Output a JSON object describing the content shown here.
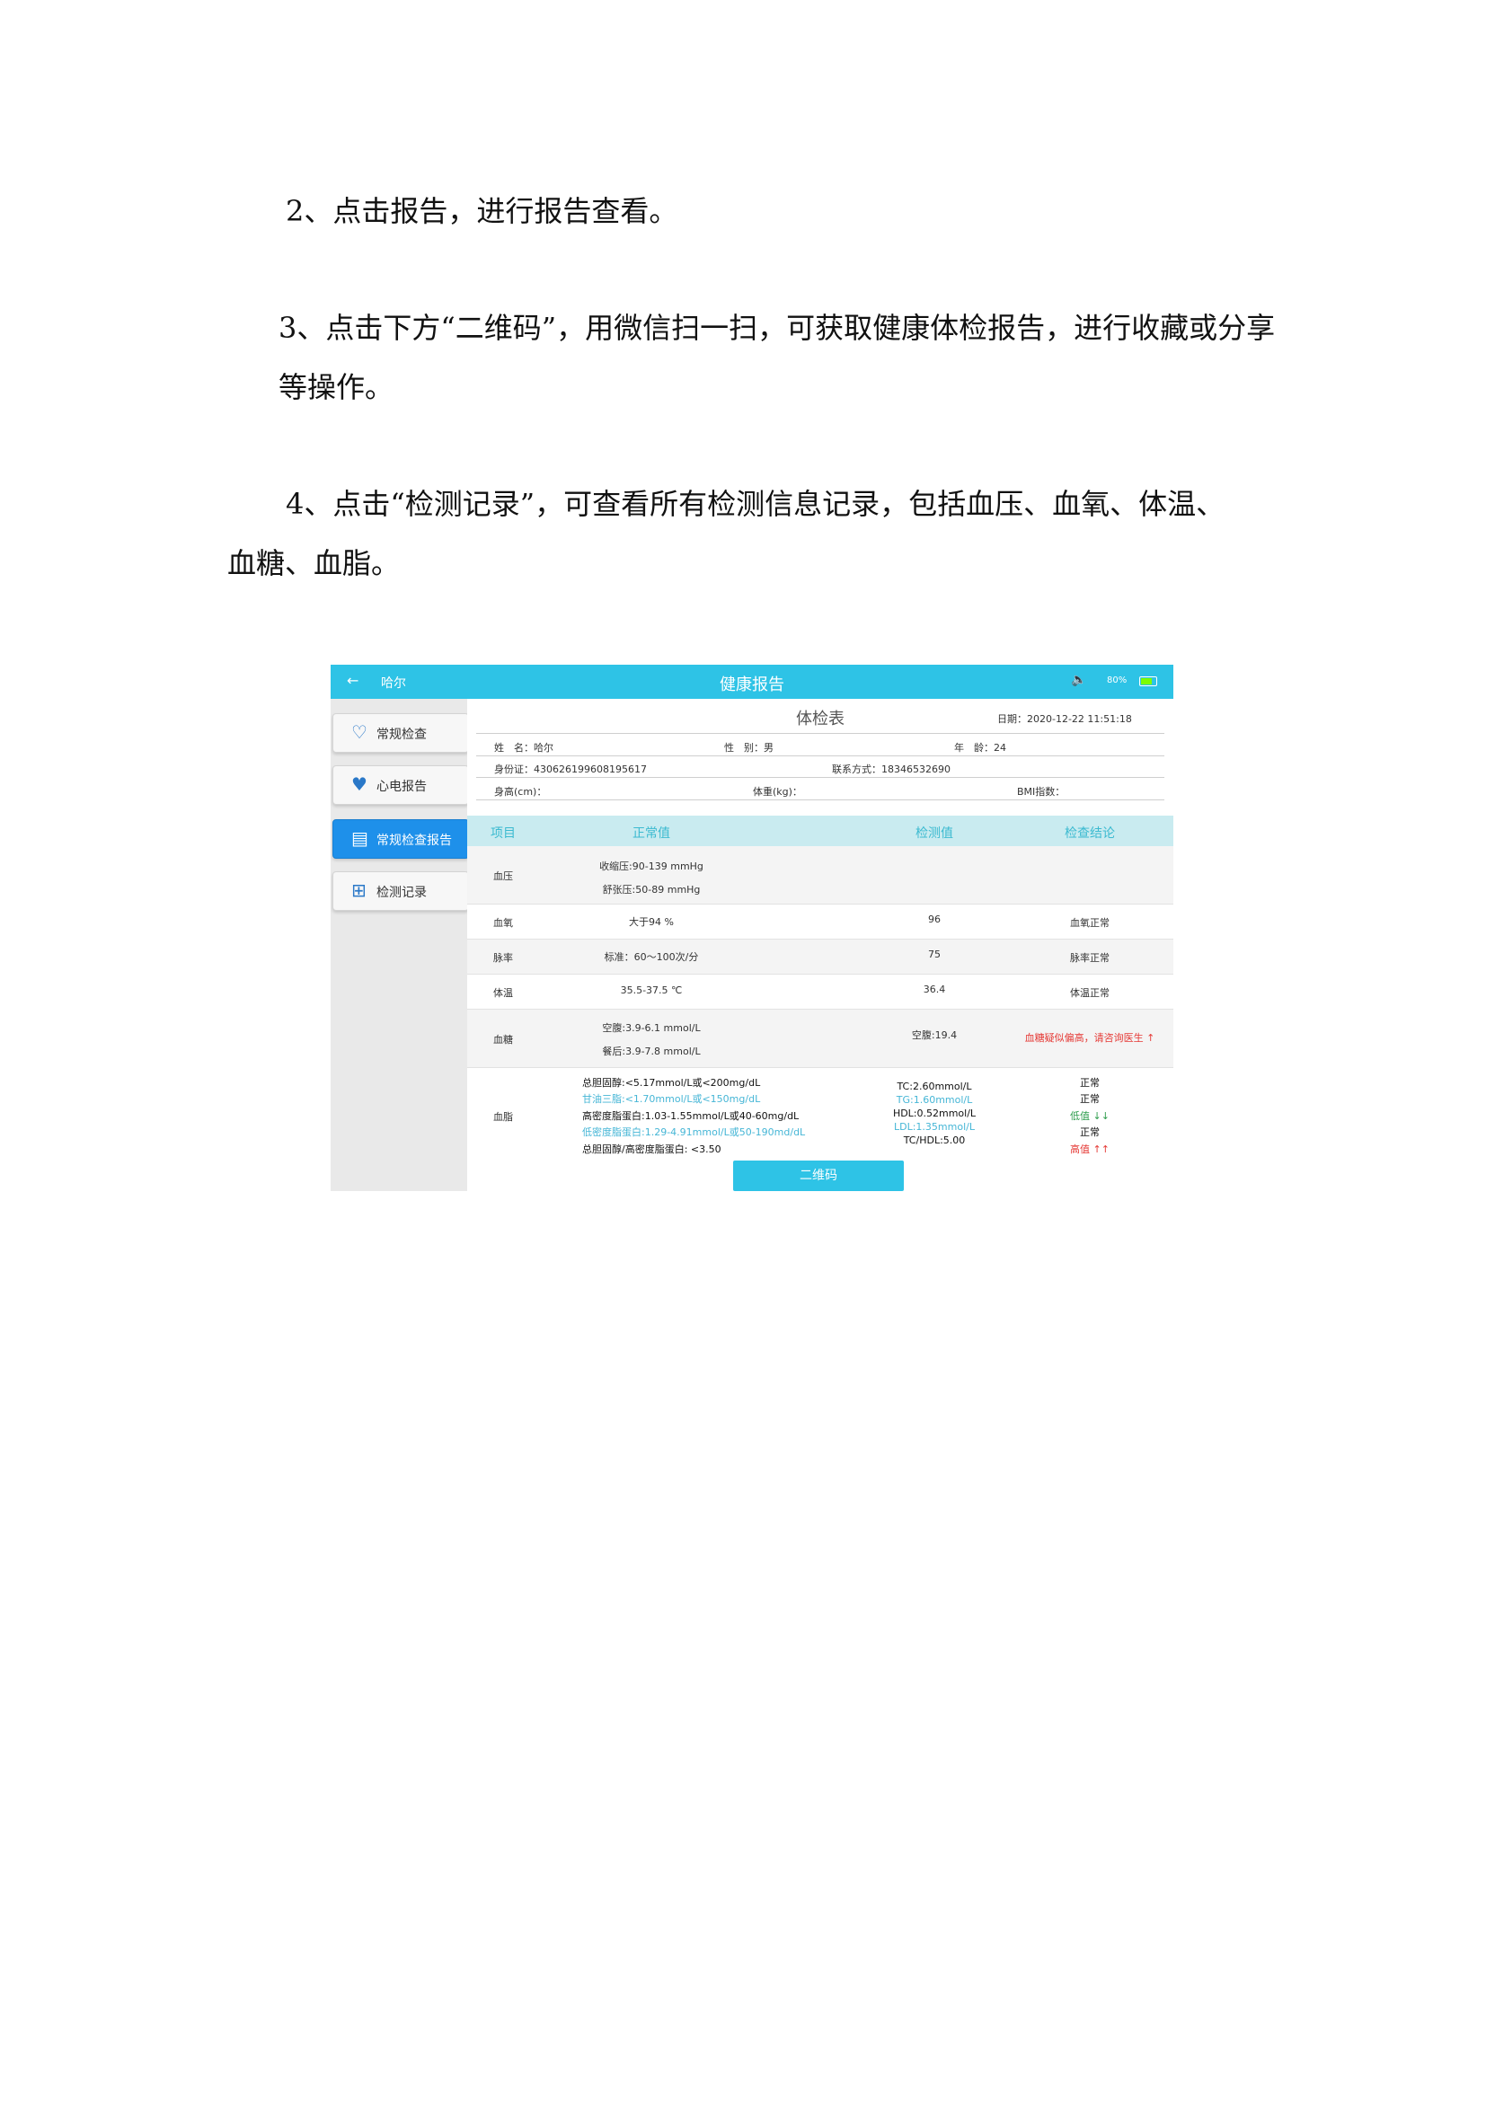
{
  "paragraphs": {
    "p2": "2、点击报告，进行报告查看。",
    "p3": "3、点击下方“二维码”，用微信扫一扫，可获取健康体检报告，进行收藏或分享等操作。",
    "p4_line1": "4、点击“检测记录”，可查看所有检测信息记录，包括血压、血氧、体温、",
    "p4_line2": "血糖、血脂。"
  },
  "app": {
    "back_icon": "←",
    "user_name": "哈尔",
    "title": "健康报告",
    "volume_icon": "🔈",
    "battery_text": "80%",
    "colors": {
      "accent": "#2ec3e6",
      "active_button": "#1e90ea",
      "abnormal": "#e53935",
      "low": "#2e9d4d"
    }
  },
  "sidebar": {
    "items": [
      {
        "icon": "stethoscope-icon",
        "glyph": "♡",
        "label": "常规检查"
      },
      {
        "icon": "heart-pulse-icon",
        "glyph": "♥",
        "label": "心电报告"
      },
      {
        "icon": "report-icon",
        "glyph": "▤",
        "label": "常规检查报告"
      },
      {
        "icon": "record-icon",
        "glyph": "⊞",
        "label": "检测记录"
      }
    ]
  },
  "sheet": {
    "title": "体检表",
    "date": "日期：2020-12-22 11:51:18",
    "name": "姓　名：哈尔",
    "gender": "性　别：男",
    "age": "年　龄：24",
    "id_card": "身份证：430626199608195617",
    "contact": "联系方式：18346532690",
    "height": "身高(cm)：",
    "weight": "体重(kg)：",
    "bmi": "BMI指数："
  },
  "table": {
    "headers": [
      "项目",
      "正常值",
      "检测值",
      "检查结论"
    ],
    "bp": {
      "item": "血压",
      "range1": "收缩压:90-139 mmHg",
      "range2": "舒张压:50-89 mmHg",
      "value": "",
      "result": ""
    },
    "spo2": {
      "item": "血氧",
      "range": "大于94 %",
      "value": "96",
      "result": "血氧正常"
    },
    "pulse": {
      "item": "脉率",
      "range": "标准：60～100次/分",
      "value": "75",
      "result": "脉率正常"
    },
    "temp": {
      "item": "体温",
      "range": "35.5-37.5 ℃",
      "value": "36.4",
      "result": "体温正常"
    },
    "glucose": {
      "item": "血糖",
      "range1": "空腹:3.9-6.1 mmol/L",
      "range2": "餐后:3.9-7.8 mmol/L",
      "value": "空腹:19.4",
      "result": "血糖疑似偏高，请咨询医生 ↑"
    },
    "lipid": {
      "item": "血脂",
      "ranges": [
        "总胆固醇:<5.17mmol/L或<200mg/dL",
        "甘油三脂:<1.70mmol/L或<150mg/dL",
        "高密度脂蛋白:1.03-1.55mmol/L或40-60mg/dL",
        "低密度脂蛋白:1.29-4.91mmol/L或50-190md/dL",
        "总胆固醇/高密度脂蛋白: <3.50"
      ],
      "values": [
        "TC:2.60mmol/L",
        "TG:1.60mmol/L",
        "HDL:0.52mmol/L",
        "LDL:1.35mmol/L",
        "TC/HDL:5.00"
      ],
      "results": [
        "正常",
        "正常",
        "低值 ↓↓",
        "正常",
        "高值 ↑↑"
      ]
    }
  },
  "qr_button": "二维码"
}
